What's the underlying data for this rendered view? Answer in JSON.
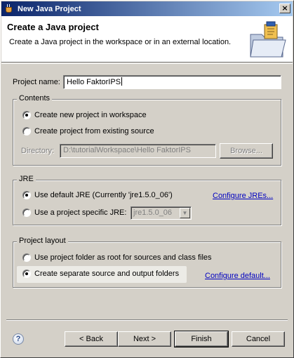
{
  "window": {
    "title": "New Java Project",
    "close_glyph": "×"
  },
  "banner": {
    "title": "Create a Java project",
    "description": "Create a Java project in the workspace or in an external location.",
    "icon": "java-project-folder-icon"
  },
  "project_name": {
    "label": "Project name:",
    "value": "Hello FaktorIPS"
  },
  "contents": {
    "label": "Contents",
    "option_new": "Create new project in workspace",
    "option_existing": "Create project from existing source",
    "directory_label": "Directory:",
    "directory_value": "D:\\tutorialWorkspace\\Hello FaktorIPS",
    "browse_label": "Browse...",
    "selected": "new"
  },
  "jre": {
    "label": "JRE",
    "option_default": "Use default JRE (Currently 'jre1.5.0_06')",
    "option_specific": "Use a project specific JRE:",
    "specific_value": "jre1.5.0_06",
    "configure_link": "Configure JREs...",
    "selected": "default"
  },
  "layout": {
    "label": "Project layout",
    "option_root": "Use project folder as root for sources and class files",
    "option_separate": "Create separate source and output folders",
    "configure_link": "Configure default...",
    "selected": "separate"
  },
  "buttons": {
    "help": "?",
    "back": "< Back",
    "next": "Next >",
    "finish": "Finish",
    "cancel": "Cancel"
  }
}
